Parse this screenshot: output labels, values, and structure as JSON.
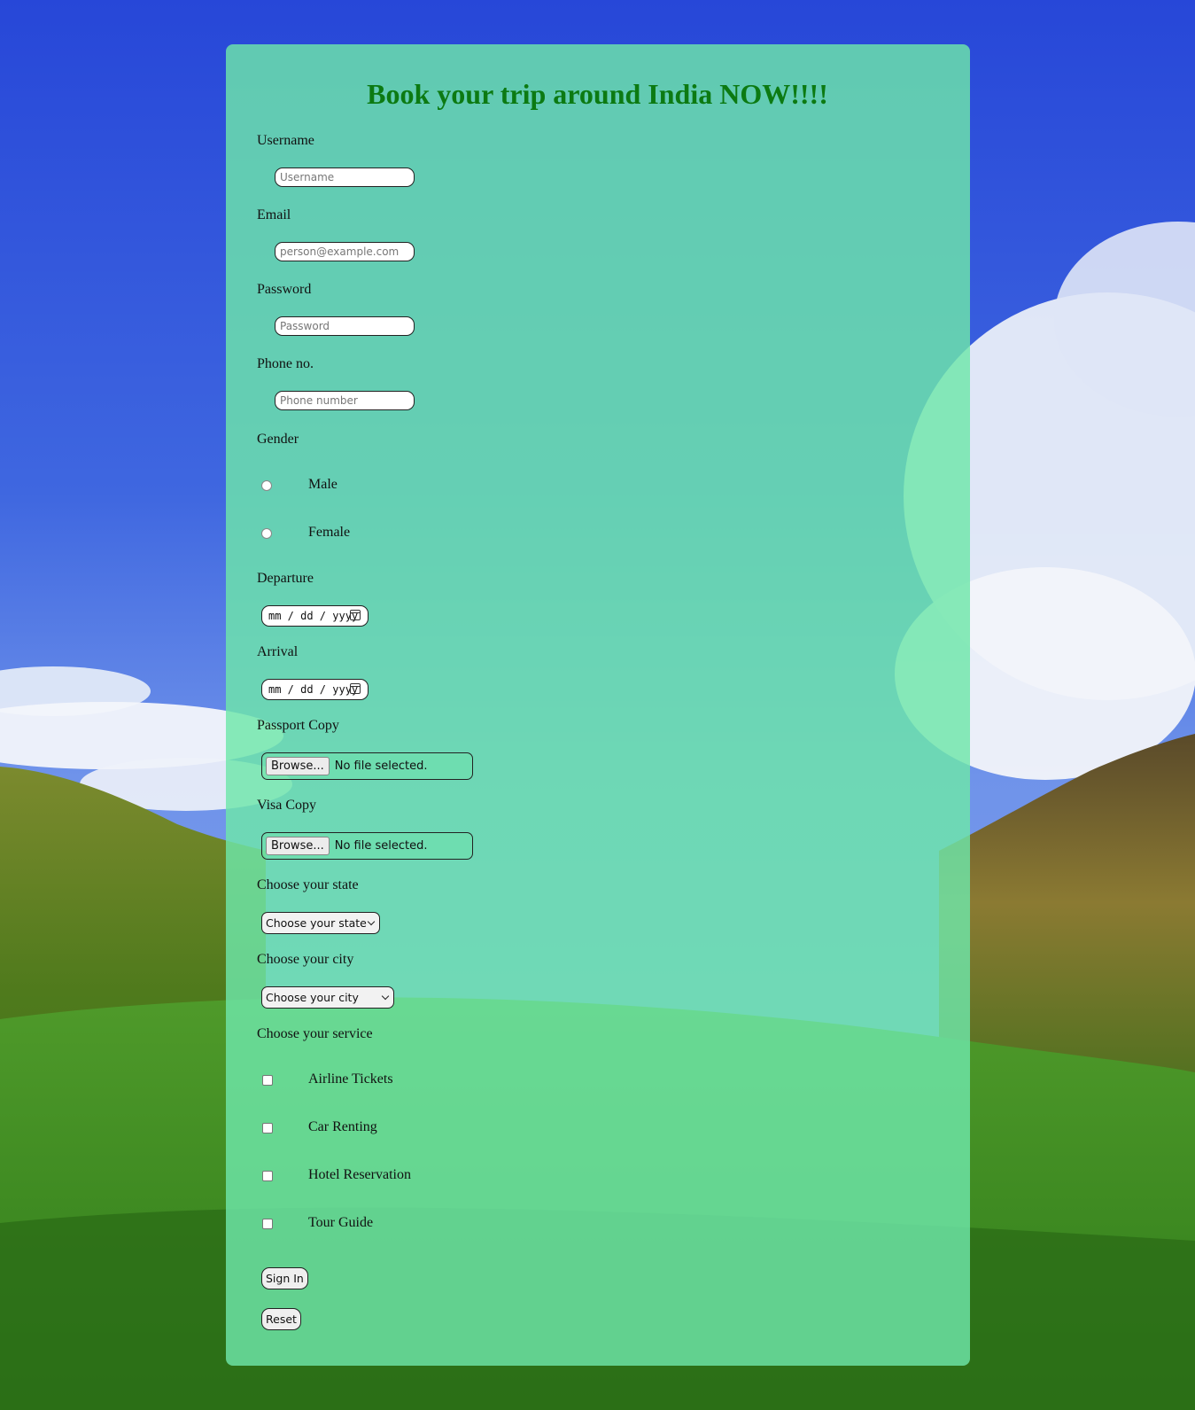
{
  "form": {
    "title": "Book your trip around India NOW!!!!",
    "username": {
      "label": "Username",
      "placeholder": "Username"
    },
    "email": {
      "label": "Email",
      "placeholder": "person@example.com"
    },
    "password": {
      "label": "Password",
      "placeholder": "Password"
    },
    "phone": {
      "label": "Phone no.",
      "placeholder": "Phone number"
    },
    "gender": {
      "label": "Gender",
      "options": [
        "Male",
        "Female"
      ]
    },
    "departure": {
      "label": "Departure",
      "value": "mm / dd / yyyy"
    },
    "arrival": {
      "label": "Arrival",
      "value": "mm / dd / yyyy"
    },
    "passport": {
      "label": "Passport Copy",
      "button": "Browse...",
      "status": "No file selected."
    },
    "visa": {
      "label": "Visa Copy",
      "button": "Browse...",
      "status": "No file selected."
    },
    "state": {
      "label": "Choose your state",
      "selected": "Choose your state"
    },
    "city": {
      "label": "Choose your city",
      "selected": "Choose your city"
    },
    "service": {
      "label": "Choose your service",
      "options": [
        "Airline Tickets",
        "Car Renting",
        "Hotel Reservation",
        "Tour Guide"
      ]
    },
    "sign_in_label": "Sign In",
    "reset_label": "Reset"
  },
  "colors": {
    "title": "#0c7a12",
    "card": "#6ee6aa"
  }
}
